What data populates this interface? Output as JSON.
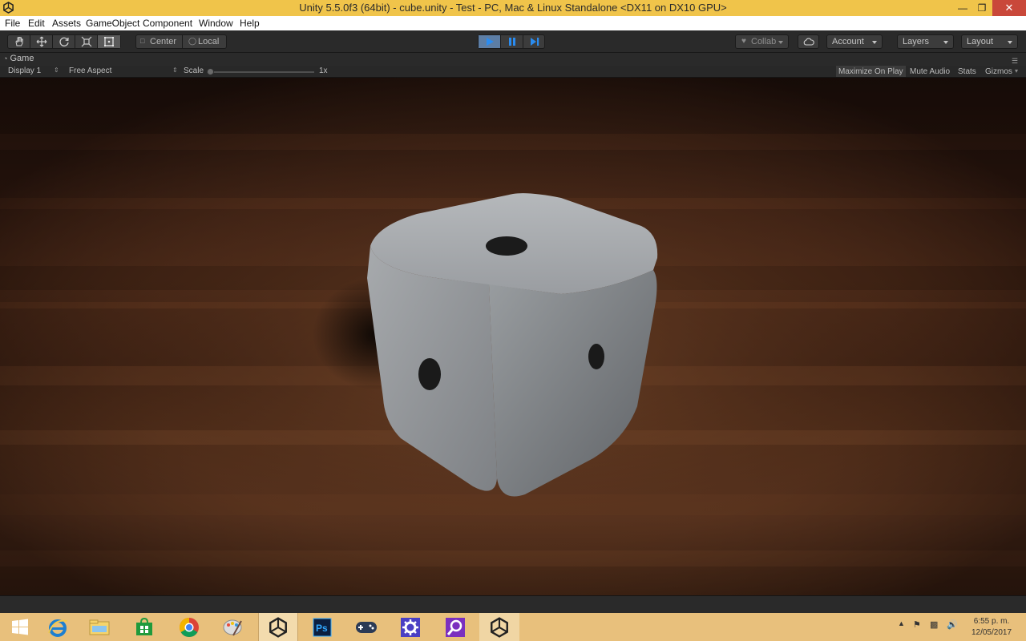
{
  "window": {
    "title": "Unity 5.5.0f3 (64bit) - cube.unity - Test - PC, Mac & Linux Standalone <DX11 on DX10 GPU>",
    "controls": [
      "minimize",
      "maximize",
      "close"
    ]
  },
  "menu": {
    "items": [
      "File",
      "Edit",
      "Assets",
      "GameObject",
      "Component",
      "Window",
      "Help"
    ]
  },
  "toolbar": {
    "tools": [
      "hand-tool",
      "move-tool",
      "rotate-tool",
      "scale-tool",
      "rect-tool"
    ],
    "active_tool": "rect-tool",
    "pivot_mode": "Center",
    "pivot_rotation": "Local",
    "play_state": "playing",
    "collab_label": "Collab",
    "account_label": "Account",
    "layers_label": "Layers",
    "layout_label": "Layout"
  },
  "game_view": {
    "tab_label": "Game",
    "display": "Display 1",
    "aspect": "Free Aspect",
    "scale_label": "Scale",
    "scale_value": "1x",
    "maximize_on_play": "Maximize On Play",
    "mute_audio": "Mute Audio",
    "stats": "Stats",
    "gizmos": "Gizmos"
  },
  "taskbar": {
    "apps": [
      "start",
      "internet-explorer",
      "file-explorer",
      "store",
      "chrome",
      "paint",
      "unity",
      "photoshop",
      "game-controller",
      "settings",
      "search-app",
      "unity"
    ],
    "active_app_index": 6,
    "clock_time": "6:55 p. m.",
    "clock_date": "12/05/2017"
  },
  "colors": {
    "titlebar": "#f0c44a",
    "toolbar": "#2a2a2a",
    "play_active": "#5d7ea5",
    "taskbar": "#e8c07c"
  }
}
